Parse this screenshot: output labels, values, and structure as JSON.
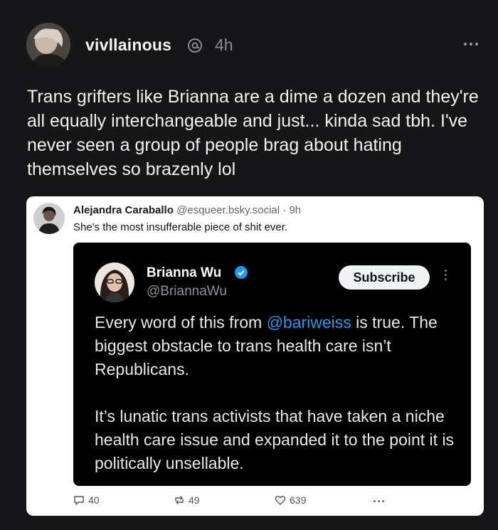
{
  "post": {
    "username": "vivllainous",
    "time": "4h",
    "text": "Trans grifters like Brianna are a dime a dozen and they're all equally interchangeable and just... kinda sad tbh. I've never seen a group of people brag about hating themselves so brazenly lol"
  },
  "quoted": {
    "author": "Alejandra Caraballo",
    "handle": "@esqueer.bsky.social",
    "separator": " · ",
    "time": "9h",
    "text": "She's the most insufferable piece of shit ever.",
    "tweet": {
      "name": "Brianna Wu",
      "handle": "@BriannaWu",
      "subscribe_label": "Subscribe",
      "p1_before": "Every word of this from ",
      "p1_mention": "@bariweiss",
      "p1_after": " is true. The biggest obstacle to trans health care isn’t Republicans.",
      "p2": "It’s lunatic trans activists that have taken a niche health care issue and expanded it to the point it is politically unsellable."
    },
    "actions": {
      "replies": "40",
      "reposts": "49",
      "likes": "639"
    }
  },
  "icons": [
    "threads-icon",
    "more-icon",
    "verified-icon",
    "reply-icon",
    "repost-icon",
    "heart-icon"
  ],
  "colors": {
    "background": "#161618",
    "mention": "#1d9bf0",
    "verified": "#1d9bf0"
  }
}
